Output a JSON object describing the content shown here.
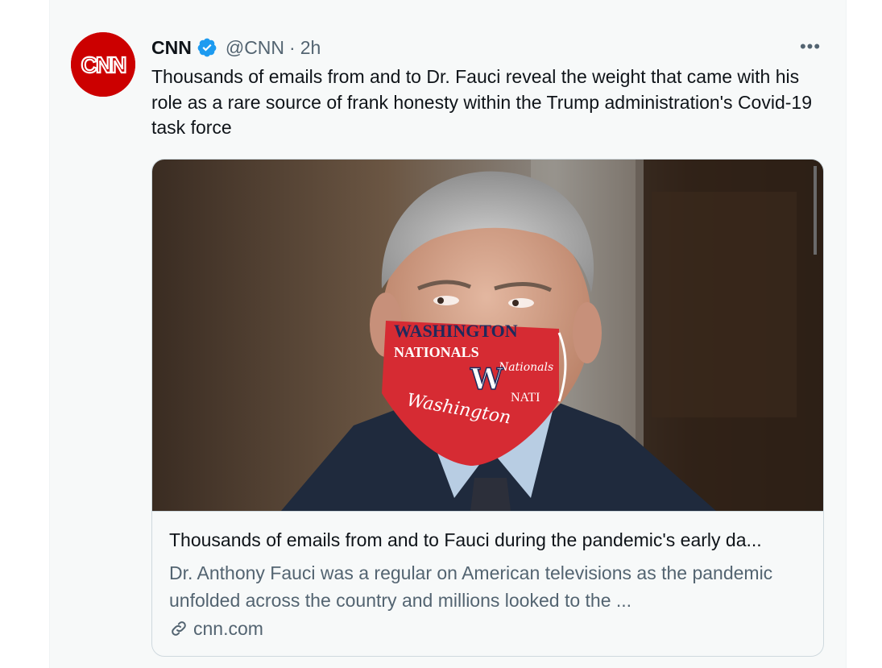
{
  "tweet": {
    "author_name": "CNN",
    "author_handle": "@CNN",
    "separator": "·",
    "time": "2h",
    "more_label": "•••",
    "text": "Thousands of emails from and to Dr. Fauci reveal the weight that came with his role as a rare source of frank honesty within the Trump administration's Covid-19 task force",
    "avatar_text": "CNN"
  },
  "card": {
    "title": "Thousands of emails from and to Fauci during the pandemic's early da...",
    "description": "Dr. Anthony Fauci was a regular on American televisions as the pandemic unfolded across the country and millions looked to the ...",
    "domain": "cnn.com",
    "image_alt": "Man in dark suit wearing a red Washington Nationals face mask",
    "mask_text_1": "WASHINGTON",
    "mask_text_2": "NATIONALS",
    "mask_text_3": "Washington",
    "mask_text_4": "Nationals"
  },
  "colors": {
    "cnn_red": "#cc0000",
    "verified_blue": "#1d9bf0",
    "text_primary": "#0f1419",
    "text_secondary": "#536471",
    "border": "#cfd9de"
  },
  "icons": {
    "verified": "verified-badge-icon",
    "more": "more-dots-icon",
    "link": "link-icon"
  }
}
